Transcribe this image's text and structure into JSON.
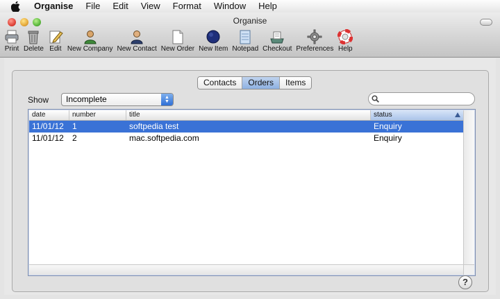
{
  "menubar": {
    "app_name": "Organise",
    "items": [
      "File",
      "Edit",
      "View",
      "Format",
      "Window",
      "Help"
    ]
  },
  "window": {
    "title": "Organise"
  },
  "toolbar": [
    {
      "label": "Print",
      "icon": "printer-icon"
    },
    {
      "label": "Delete",
      "icon": "trash-icon"
    },
    {
      "label": "Edit",
      "icon": "edit-icon"
    },
    {
      "label": "New Company",
      "icon": "company-icon"
    },
    {
      "label": "New Contact",
      "icon": "contact-icon"
    },
    {
      "label": "New Order",
      "icon": "order-icon"
    },
    {
      "label": "New Item",
      "icon": "item-icon"
    },
    {
      "label": "Notepad",
      "icon": "notepad-icon"
    },
    {
      "label": "Checkout",
      "icon": "checkout-icon"
    },
    {
      "label": "Preferences",
      "icon": "gear-icon"
    },
    {
      "label": "Help",
      "icon": "lifebuoy-icon"
    }
  ],
  "tabs": [
    {
      "label": "Contacts",
      "active": false
    },
    {
      "label": "Orders",
      "active": true
    },
    {
      "label": "Items",
      "active": false
    }
  ],
  "filter": {
    "label": "Show",
    "selected": "Incomplete"
  },
  "search": {
    "placeholder": ""
  },
  "table": {
    "columns": [
      "date",
      "number",
      "title",
      "status"
    ],
    "rows": [
      {
        "date": "11/01/12",
        "number": "1",
        "title": "softpedia test",
        "status": "Enquiry",
        "selected": true
      },
      {
        "date": "11/01/12",
        "number": "2",
        "title": "mac.softpedia.com",
        "status": "Enquiry",
        "selected": false
      }
    ]
  },
  "colors": {
    "selection": "#3a72d6",
    "accent": "#2f6fd6"
  }
}
